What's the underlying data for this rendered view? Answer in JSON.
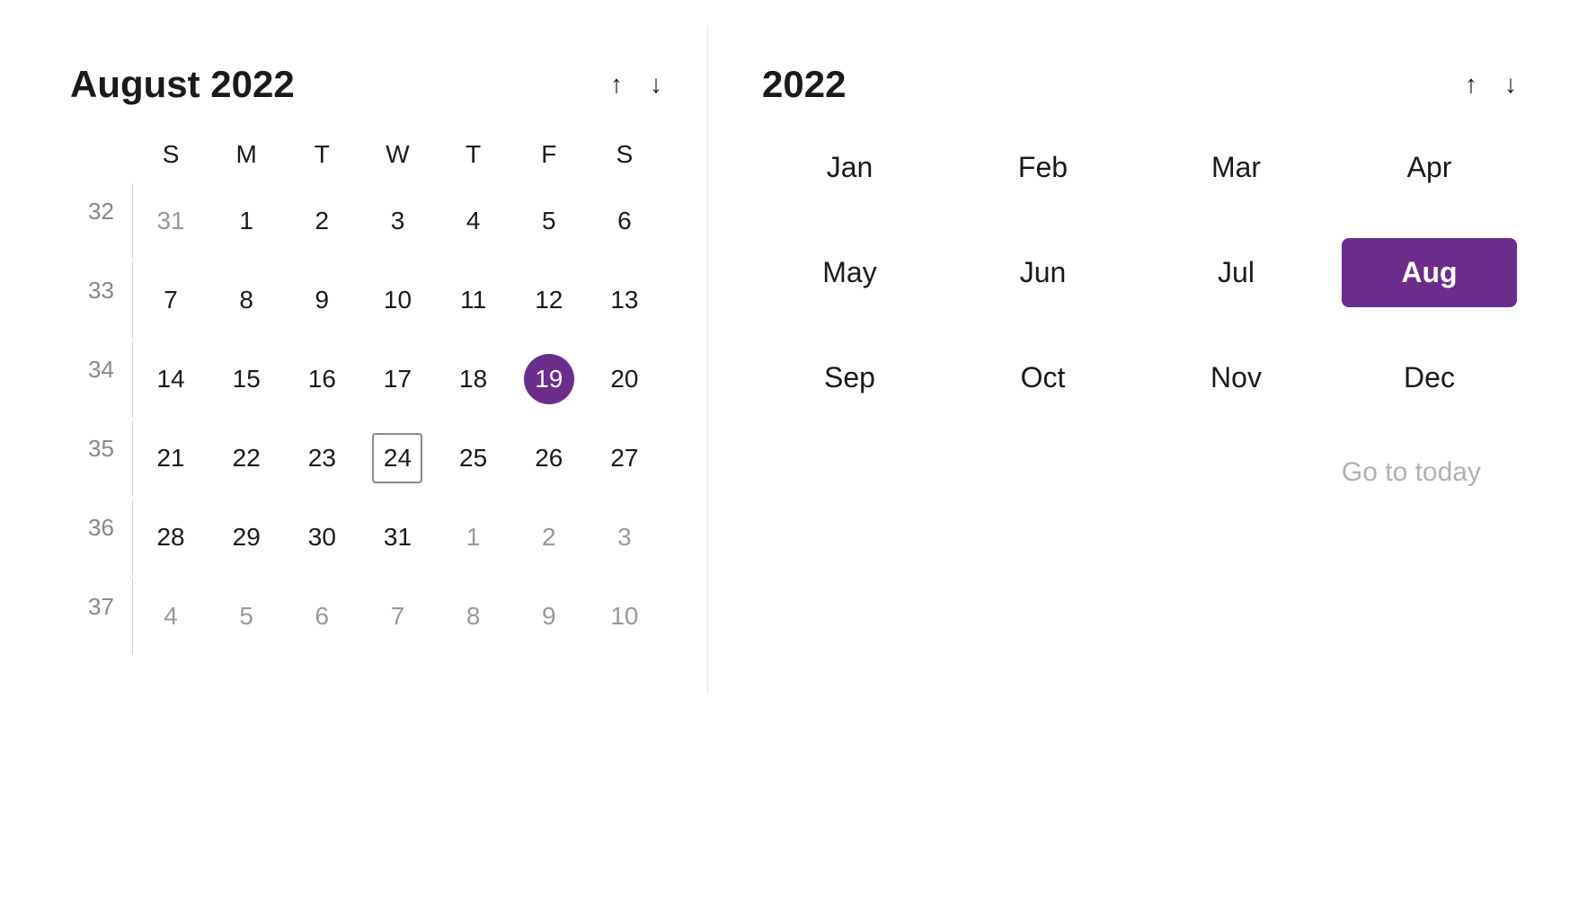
{
  "left_panel": {
    "title": "August 2022",
    "nav_up_label": "↑",
    "nav_down_label": "↓",
    "day_headers": [
      "S",
      "M",
      "T",
      "W",
      "T",
      "F",
      "S"
    ],
    "weeks": [
      {
        "week_num": "32",
        "days": [
          {
            "label": "31",
            "state": "other-month"
          },
          {
            "label": "1",
            "state": ""
          },
          {
            "label": "2",
            "state": ""
          },
          {
            "label": "3",
            "state": ""
          },
          {
            "label": "4",
            "state": ""
          },
          {
            "label": "5",
            "state": ""
          },
          {
            "label": "6",
            "state": ""
          }
        ]
      },
      {
        "week_num": "33",
        "days": [
          {
            "label": "7",
            "state": ""
          },
          {
            "label": "8",
            "state": ""
          },
          {
            "label": "9",
            "state": ""
          },
          {
            "label": "10",
            "state": ""
          },
          {
            "label": "11",
            "state": ""
          },
          {
            "label": "12",
            "state": ""
          },
          {
            "label": "13",
            "state": ""
          }
        ]
      },
      {
        "week_num": "34",
        "days": [
          {
            "label": "14",
            "state": ""
          },
          {
            "label": "15",
            "state": ""
          },
          {
            "label": "16",
            "state": ""
          },
          {
            "label": "17",
            "state": ""
          },
          {
            "label": "18",
            "state": ""
          },
          {
            "label": "19",
            "state": "selected"
          },
          {
            "label": "20",
            "state": ""
          }
        ]
      },
      {
        "week_num": "35",
        "days": [
          {
            "label": "21",
            "state": ""
          },
          {
            "label": "22",
            "state": ""
          },
          {
            "label": "23",
            "state": ""
          },
          {
            "label": "24",
            "state": "today-outline"
          },
          {
            "label": "25",
            "state": ""
          },
          {
            "label": "26",
            "state": ""
          },
          {
            "label": "27",
            "state": ""
          }
        ]
      },
      {
        "week_num": "36",
        "days": [
          {
            "label": "28",
            "state": ""
          },
          {
            "label": "29",
            "state": ""
          },
          {
            "label": "30",
            "state": ""
          },
          {
            "label": "31",
            "state": ""
          },
          {
            "label": "1",
            "state": "other-month"
          },
          {
            "label": "2",
            "state": "other-month"
          },
          {
            "label": "3",
            "state": "other-month"
          }
        ]
      },
      {
        "week_num": "37",
        "days": [
          {
            "label": "4",
            "state": "other-month"
          },
          {
            "label": "5",
            "state": "other-month"
          },
          {
            "label": "6",
            "state": "other-month"
          },
          {
            "label": "7",
            "state": "other-month"
          },
          {
            "label": "8",
            "state": "other-month"
          },
          {
            "label": "9",
            "state": "other-month"
          },
          {
            "label": "10",
            "state": "other-month"
          }
        ]
      }
    ]
  },
  "right_panel": {
    "year": "2022",
    "nav_up_label": "↑",
    "nav_down_label": "↓",
    "months": [
      {
        "label": "Jan",
        "active": false
      },
      {
        "label": "Feb",
        "active": false
      },
      {
        "label": "Mar",
        "active": false
      },
      {
        "label": "Apr",
        "active": false
      },
      {
        "label": "May",
        "active": false
      },
      {
        "label": "Jun",
        "active": false
      },
      {
        "label": "Jul",
        "active": false
      },
      {
        "label": "Aug",
        "active": true
      },
      {
        "label": "Sep",
        "active": false
      },
      {
        "label": "Oct",
        "active": false
      },
      {
        "label": "Nov",
        "active": false
      },
      {
        "label": "Dec",
        "active": false
      }
    ],
    "go_to_today_label": "Go to today"
  }
}
